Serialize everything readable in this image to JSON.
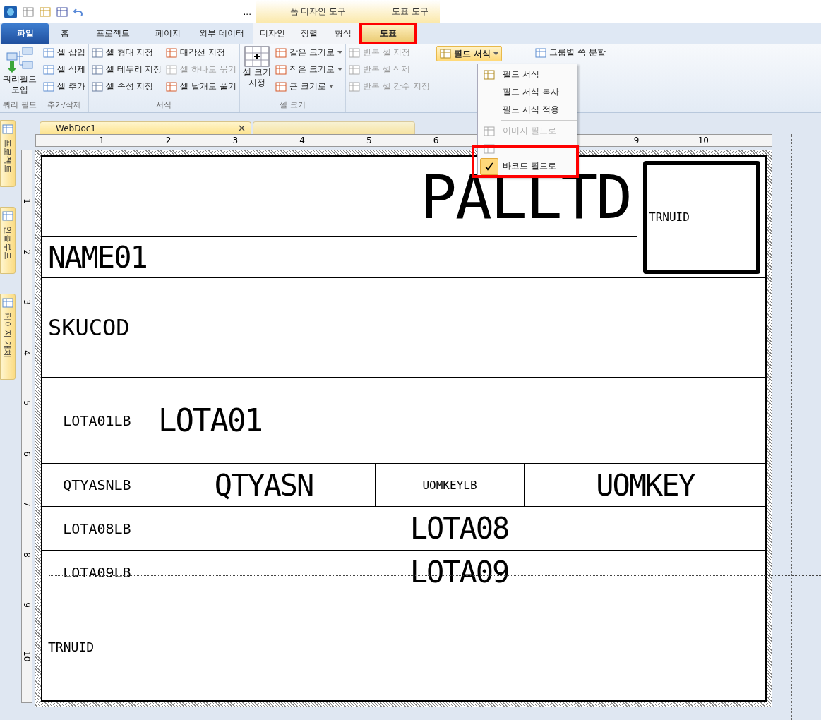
{
  "quick_access": {
    "more": "..."
  },
  "context_groups": [
    {
      "label": "폼 디자인 도구"
    },
    {
      "label": "도표 도구"
    }
  ],
  "menu_tabs": [
    {
      "label": "파일",
      "kind": "file",
      "selected": false
    },
    {
      "label": "홈",
      "kind": "tab",
      "selected": false
    },
    {
      "label": "프로젝트",
      "kind": "tab",
      "selected": false
    },
    {
      "label": "페이지",
      "kind": "tab",
      "selected": false
    },
    {
      "label": "외부 데이터",
      "kind": "tab",
      "selected": false
    },
    {
      "label": "디자인",
      "kind": "context",
      "selected": false
    },
    {
      "label": "정렬",
      "kind": "context",
      "selected": false
    },
    {
      "label": "형식",
      "kind": "context",
      "selected": false
    },
    {
      "label": "도표",
      "kind": "context2",
      "selected": true
    }
  ],
  "ribbon_groups": [
    {
      "label": "쿼리 필드",
      "kind": "big",
      "items": [
        {
          "label": "쿼리필드\n도입",
          "disabled": false
        }
      ]
    },
    {
      "label": "추가/삭제",
      "kind": "list",
      "items": [
        {
          "label": "셀 삽입",
          "disabled": false
        },
        {
          "label": "셀 삭제",
          "disabled": false
        },
        {
          "label": "셀 추가",
          "disabled": false
        }
      ]
    },
    {
      "label": "서식",
      "kind": "list2",
      "items": [
        {
          "label": "셀 형태 지정",
          "disabled": false
        },
        {
          "label": "셀 테두리 지정",
          "disabled": false
        },
        {
          "label": "셀 속성 지정",
          "disabled": false
        },
        {
          "label": "대각선 지정",
          "disabled": false
        },
        {
          "label": "셀 하나로 묶기",
          "disabled": true
        },
        {
          "label": "셀 낱개로 풀기",
          "disabled": false
        }
      ]
    },
    {
      "label": "셀 크기",
      "kind": "bigplus",
      "items": [
        {
          "label": "셀 크기\n지정",
          "disabled": false
        },
        {
          "label": "같은 크기로",
          "disabled": false
        },
        {
          "label": "작은 크기로",
          "disabled": false
        },
        {
          "label": "큰 크기로",
          "disabled": false
        }
      ]
    },
    {
      "kind": "list",
      "items": [
        {
          "label": "반복 셀 지정",
          "disabled": true
        },
        {
          "label": "반복 셀 삭제",
          "disabled": true
        },
        {
          "label": "반복 셀 칸수 지정",
          "disabled": true
        }
      ]
    },
    {
      "kind": "split",
      "items": [
        {
          "label": "필드 서식",
          "disabled": false
        }
      ]
    },
    {
      "kind": "list",
      "items": [
        {
          "label": "그룹별 쪽 분할",
          "disabled": false
        }
      ]
    }
  ],
  "field_format_menu": [
    {
      "label": "필드 서식",
      "disabled": false,
      "checked": false
    },
    {
      "label": "필드 서식 복사",
      "disabled": false,
      "checked": false
    },
    {
      "label": "필드 서식 적용",
      "disabled": false,
      "checked": false
    },
    {
      "label": "이미지 필드로",
      "disabled": true,
      "checked": false
    },
    {
      "disabled": true,
      "checked": false
    },
    {
      "label": "바코드 필드로",
      "disabled": false,
      "checked": true
    }
  ],
  "side_tabs": [
    {
      "label": "프로젝트"
    },
    {
      "label": "인클루드"
    },
    {
      "label": "페이지 개체"
    }
  ],
  "doc_tabs": [
    {
      "label": "WebDoc1",
      "selected": true
    },
    {
      "selected": false
    }
  ],
  "ruler": {
    "h": [
      "1",
      "2",
      "3",
      "4",
      "5",
      "6",
      "9",
      "10"
    ],
    "v": [
      "1",
      "2",
      "3",
      "4",
      "5",
      "6",
      "7",
      "8",
      "9",
      "10"
    ]
  },
  "form_cells": [
    {
      "text": "PALLTD",
      "kind": "field"
    },
    {
      "text": "TRNUID",
      "kind": "barcode"
    },
    {
      "text": "NAME01",
      "kind": "field"
    },
    {
      "text": "SKUCOD",
      "kind": "field"
    },
    {
      "text": "LOTA01LB",
      "kind": "label"
    },
    {
      "text": "LOTA01",
      "kind": "field"
    },
    {
      "text": "QTYASNLB",
      "kind": "label"
    },
    {
      "text": "QTYASN",
      "kind": "field"
    },
    {
      "text": "UOMKEYLB",
      "kind": "label"
    },
    {
      "text": "UOMKEY",
      "kind": "field"
    },
    {
      "text": "LOTA08LB",
      "kind": "label"
    },
    {
      "text": "LOTA08",
      "kind": "field"
    },
    {
      "text": "LOTA09LB",
      "kind": "label"
    },
    {
      "text": "LOTA09",
      "kind": "field"
    },
    {
      "text": "TRNUID",
      "kind": "field"
    }
  ]
}
